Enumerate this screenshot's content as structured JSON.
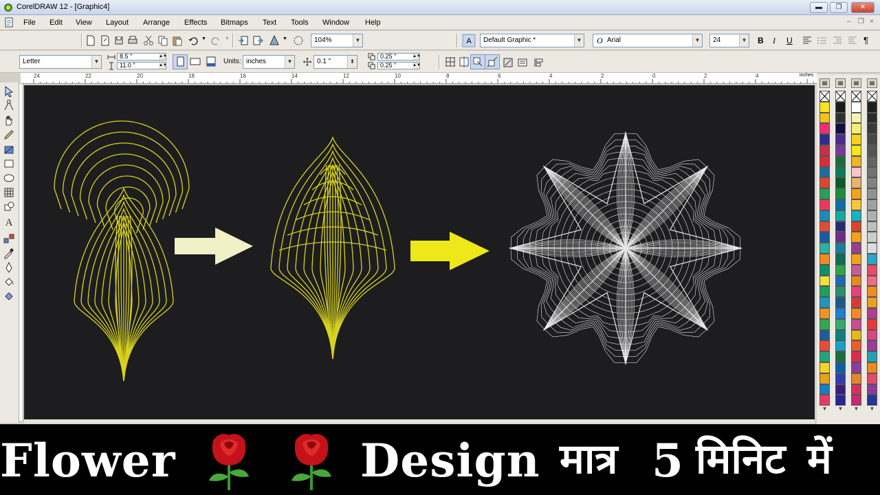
{
  "window": {
    "title": "CorelDRAW 12 - [Graphic4]",
    "minimize_label": "▬",
    "restore_label": "❐",
    "close_label": "✕"
  },
  "menu": {
    "items": [
      "File",
      "Edit",
      "View",
      "Layout",
      "Arrange",
      "Effects",
      "Bitmaps",
      "Text",
      "Tools",
      "Window",
      "Help"
    ],
    "mdi_min": "–",
    "mdi_restore": "❐",
    "mdi_close": "×"
  },
  "standard_toolbar": {
    "zoom_value": "104%",
    "style_value": "Default Graphic *",
    "font_value": "Arial",
    "font_size": "24",
    "bold_label": "B",
    "italic_label": "I",
    "underline_label": "U"
  },
  "property_bar": {
    "paper_size": "Letter",
    "width": "8.5 \"",
    "height": "11.0 \"",
    "units_label": "Units:",
    "units_value": "inches",
    "nudge": "0.1 \"",
    "dup_x": "0.25 \"",
    "dup_y": "0.25 \""
  },
  "ruler": {
    "unit": "inches",
    "ticks": [
      "24",
      "22",
      "20",
      "18",
      "16",
      "14",
      "12",
      "10",
      "8",
      "6",
      "4",
      "2",
      "0",
      "2",
      "4"
    ]
  },
  "banner": {
    "word1": "Flower",
    "word2": "Design",
    "hindi1": "मात्र",
    "number": "5",
    "hindi2": "मिनिट",
    "hindi3": "में"
  },
  "colors": {
    "canvas_bg": "#1d1d1f",
    "petal_yellow": "#d8d21e",
    "arrow_cream": "#f2f0c6",
    "arrow_yellow": "#eee81a",
    "star_white": "#e8e8e8",
    "banner_bg": "#000000"
  },
  "palettes": [
    [
      "#f7e51f",
      "#f2c31c",
      "#ef2e74",
      "#2e2a8e",
      "#c72f4b",
      "#d92c3c",
      "#1c6d9e",
      "#d9472f",
      "#2b9e5a",
      "#e53b5f",
      "#1c8dba",
      "#e24c36",
      "#1a5aa8",
      "#2bb3a6",
      "#ef8c23",
      "#0d8f68",
      "#f0e236",
      "#1e9f5b",
      "#1f95c2",
      "#ed9422",
      "#32a852",
      "#1b5e9b",
      "#e94a3a",
      "#21a87a",
      "#f4d428",
      "#e5a21e",
      "#1a7ec2",
      "#e83a66"
    ],
    [
      "#1a1a1a",
      "#2f2f2f",
      "#101040",
      "#4a2c8e",
      "#7a3a9a",
      "#1a6d3a",
      "#0f7a5a",
      "#0d5a2a",
      "#1b8d3d",
      "#0c6ea8",
      "#15a8a0",
      "#2a2a72",
      "#6e2c82",
      "#1b7e9b",
      "#0e6d52",
      "#31a34a",
      "#1b6bb4",
      "#2a8f6e",
      "#1a5a8a",
      "#1e7ecf",
      "#36a86c",
      "#0e8080",
      "#19a2c4",
      "#1b6e3d",
      "#0c5ea8",
      "#2f3eaa",
      "#3a1e7a",
      "#27259a"
    ],
    [
      "#ffffff",
      "#f7f2b4",
      "#f4ef6e",
      "#f6d21e",
      "#f2e81a",
      "#f0b42a",
      "#f6c5ca",
      "#e9b36e",
      "#f0a31e",
      "#f7c73a",
      "#1ab1c6",
      "#d9442c",
      "#f2a31a",
      "#9c3f8e",
      "#f0a41e",
      "#c45c9a",
      "#e88a1e",
      "#e5427a",
      "#d43b3a",
      "#f38a22",
      "#c84b95",
      "#e7b81a",
      "#e95d2e",
      "#d92c4f",
      "#8c3f9b",
      "#e4872f",
      "#d2325e",
      "#c82a6e"
    ],
    [
      "#1f1f1f",
      "#2b2b2b",
      "#3a3a3a",
      "#474747",
      "#555555",
      "#646464",
      "#737373",
      "#828282",
      "#919191",
      "#a0a0a0",
      "#afafaf",
      "#bebebe",
      "#cdcdcd",
      "#dcdcdc",
      "#2aa6c8",
      "#e84a6a",
      "#f06a88",
      "#f28c22",
      "#e7a11e",
      "#b13e8e",
      "#e23b3a",
      "#d94686",
      "#9b3c98",
      "#23a0b8",
      "#ea8a20",
      "#e34b6c",
      "#8b3c9a",
      "#273596"
    ]
  ]
}
